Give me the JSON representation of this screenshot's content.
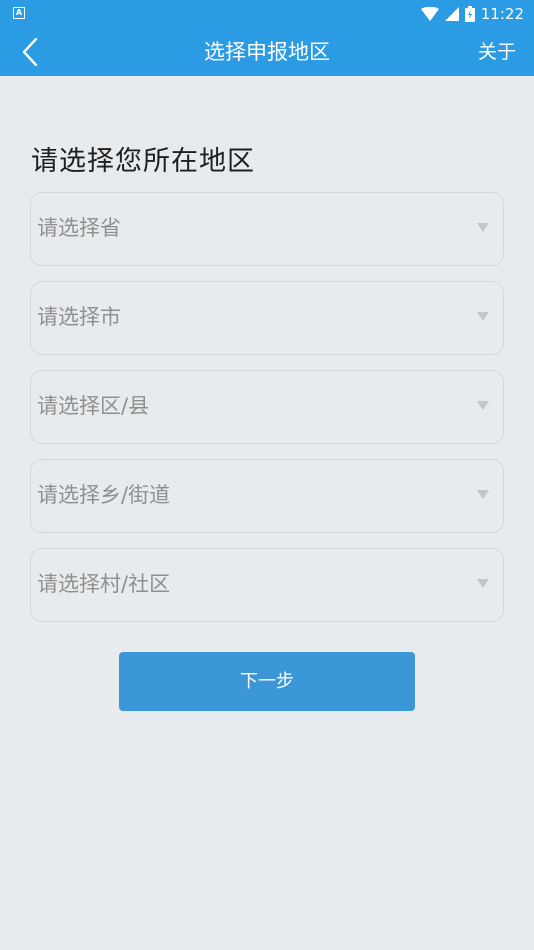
{
  "status_bar": {
    "notification_icon_letter": "A",
    "time": "11:22"
  },
  "app_bar": {
    "title": "选择申报地区",
    "about_label": "关于"
  },
  "form": {
    "heading": "请选择您所在地区",
    "selects": [
      {
        "placeholder": "请选择省"
      },
      {
        "placeholder": "请选择市"
      },
      {
        "placeholder": "请选择区/县"
      },
      {
        "placeholder": "请选择乡/街道"
      },
      {
        "placeholder": "请选择村/社区"
      }
    ],
    "next_label": "下一步"
  },
  "colors": {
    "primary": "#2b9be3",
    "button": "#3c97d8",
    "background": "#e8ebee",
    "placeholder_text": "#8f8f8f"
  }
}
